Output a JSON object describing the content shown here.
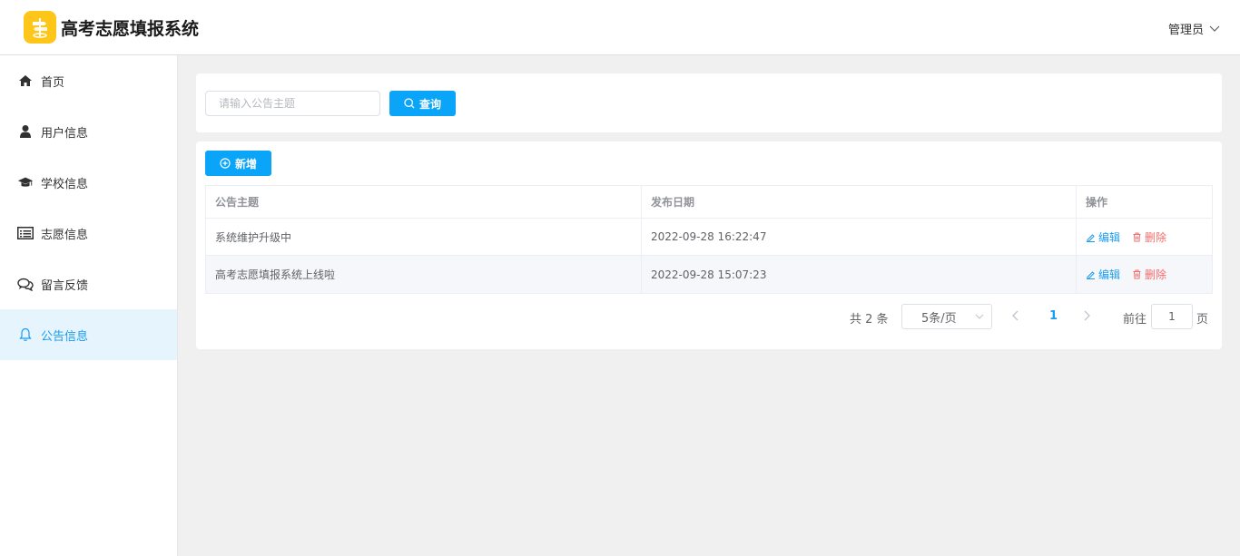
{
  "app": {
    "title": "高考志愿填报系统"
  },
  "header": {
    "user": "管理员"
  },
  "sidebar": {
    "items": [
      {
        "label": "首页",
        "icon": "home-icon"
      },
      {
        "label": "用户信息",
        "icon": "user-icon"
      },
      {
        "label": "学校信息",
        "icon": "graduation-cap-icon"
      },
      {
        "label": "志愿信息",
        "icon": "list-icon"
      },
      {
        "label": "留言反馈",
        "icon": "comments-icon"
      },
      {
        "label": "公告信息",
        "icon": "bell-icon",
        "active": true
      }
    ]
  },
  "search": {
    "placeholder": "请输入公告主题",
    "value": "",
    "button_label": "查询"
  },
  "toolbar": {
    "add_label": "新增"
  },
  "table": {
    "columns": [
      "公告主题",
      "发布日期",
      "操作"
    ],
    "rows": [
      {
        "title": "系统维护升级中",
        "date": "2022-09-28 16:22:47",
        "edit": "编辑",
        "delete": "删除"
      },
      {
        "title": "高考志愿填报系统上线啦",
        "date": "2022-09-28 15:07:23",
        "edit": "编辑",
        "delete": "删除"
      }
    ]
  },
  "pagination": {
    "total_label": "共 2 条",
    "page_size": "5条/页",
    "current_page": "1",
    "goto_label": "前往",
    "goto_value": "1",
    "page_unit": "页"
  },
  "colors": {
    "accent": "#0aa5f8",
    "danger": "#f56c6c",
    "logo": "#ffc61a",
    "active_bg": "#e6f4fe"
  }
}
